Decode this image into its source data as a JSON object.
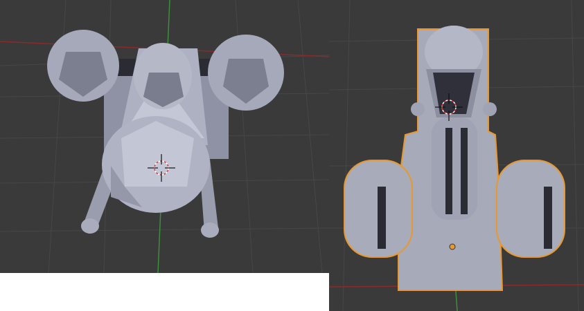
{
  "colors": {
    "viewport_bg": "#3a3a3a",
    "grid_line": "#474747",
    "x_axis": "#8c2a2a",
    "y_axis": "#3d8f3d",
    "mesh_light": "#b9bccb",
    "mesh_mid": "#9a9dae",
    "mesh_dark": "#6f7282",
    "mesh_shadow": "#2a2b33",
    "selection_outline": "#e8982e",
    "cursor_red": "#d43c3c",
    "cursor_ring": "#ffffff",
    "blank_area": "#ffffff"
  },
  "icons": {
    "left_cursor": "3d-cursor-icon",
    "right_cursor": "3d-cursor-icon",
    "origin": "object-origin-icon"
  }
}
